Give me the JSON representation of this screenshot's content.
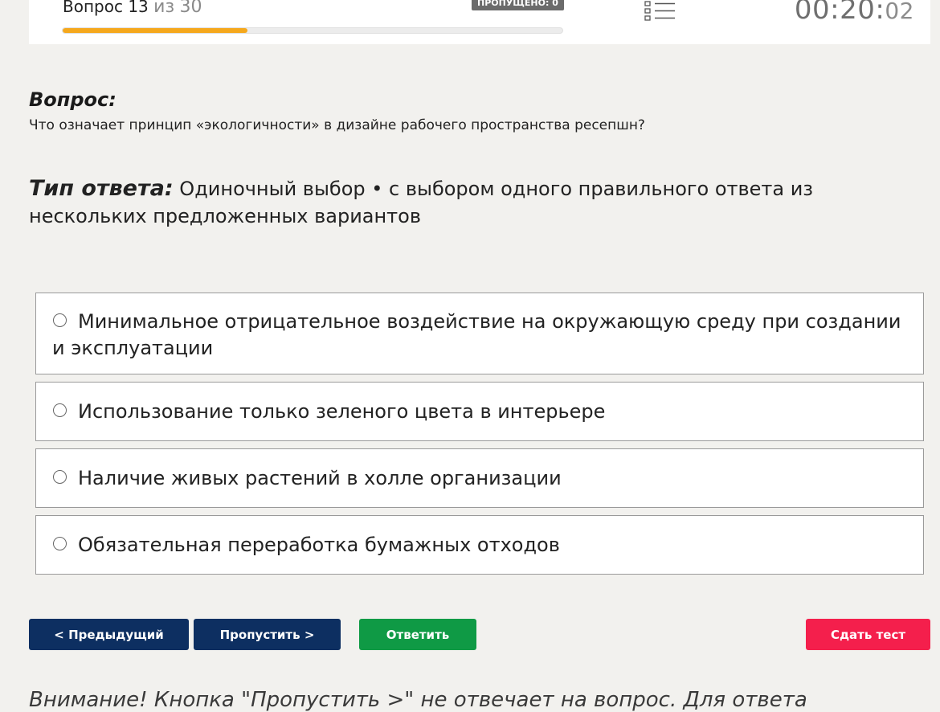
{
  "header": {
    "question_word": "Вопрос",
    "current": "13",
    "of_word": "из",
    "total": "30",
    "progress_fraction": 0.37,
    "skipped_badge": "ПРОПУЩЕНО: 0",
    "list_icon": "question-list-icon",
    "timer_main": "00:20:",
    "timer_seconds": "02"
  },
  "question": {
    "label": "Вопрос:",
    "text": "Что означает принцип «экологичности» в дизайне рабочего пространства ресепшн?"
  },
  "answer_type": {
    "label": "Тип ответа:",
    "text": "Одиночный выбор • с выбором одного правильного ответа из нескольких предложенных вариантов"
  },
  "options": [
    "Минимальное отрицательное воздействие на окружающую среду при создании и эксплуатации",
    "Использование только зеленого цвета в интерьере",
    "Наличие живых растений в холле организации",
    "Обязательная переработка бумажных отходов"
  ],
  "buttons": {
    "prev": "< Предыдущий",
    "skip": "Пропустить >",
    "answer": "Ответить",
    "submit": "Сдать тест"
  },
  "colors": {
    "progress": "#f5a81d",
    "nav_button": "#0d2f61",
    "answer_button": "#0f9a45",
    "submit_button": "#f41f4c"
  },
  "warning": "Внимание! Кнопка \"Пропустить >\" не отвечает на вопрос. Для ответа"
}
